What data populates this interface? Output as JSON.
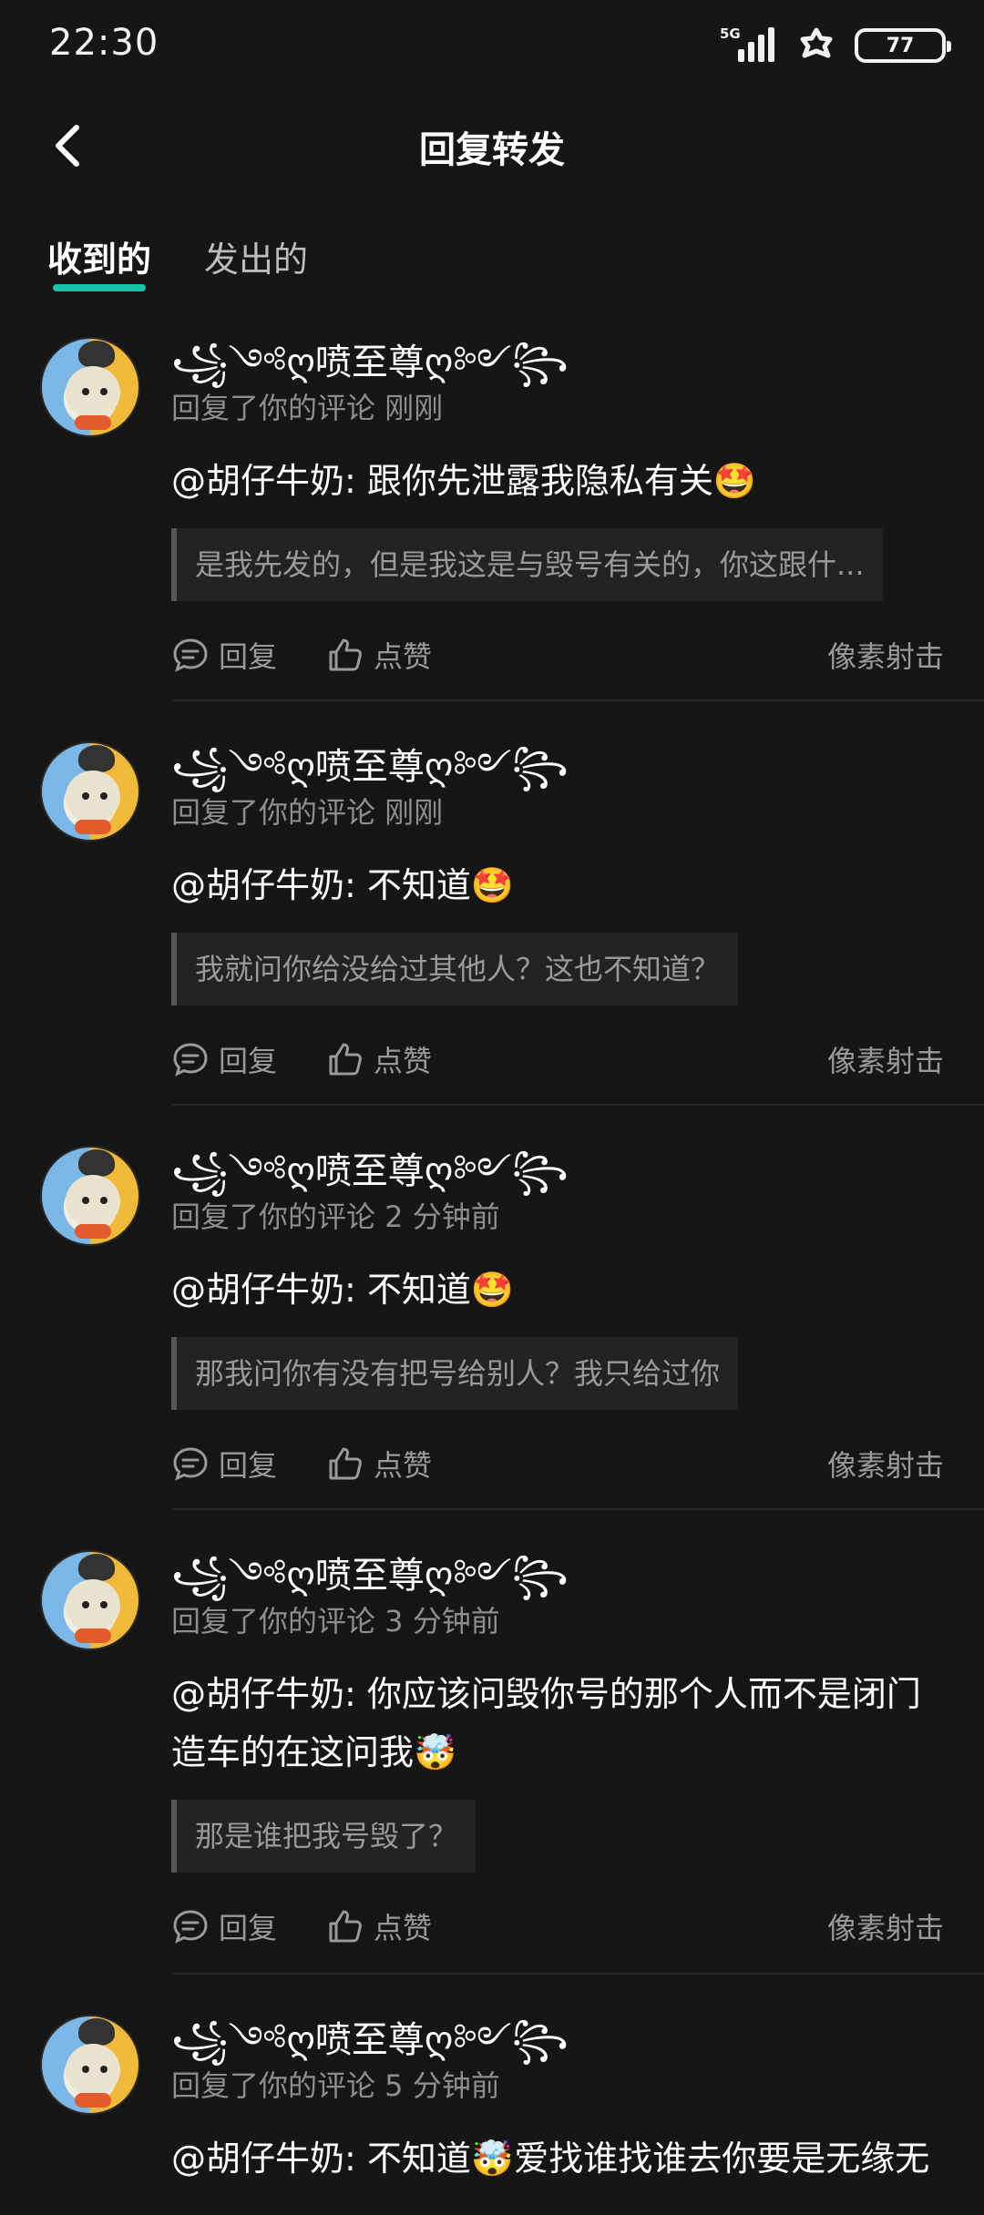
{
  "status_bar": {
    "time": "22:30",
    "network": "5G",
    "battery": "77"
  },
  "header": {
    "title": "回复转发"
  },
  "tabs": [
    {
      "label": "收到的",
      "active": true
    },
    {
      "label": "发出的",
      "active": false
    }
  ],
  "action_labels": {
    "reply": "回复",
    "like": "点赞"
  },
  "items": [
    {
      "username": "꧁༺ღ喷至尊ღ༻꧂",
      "meta": "回复了你的评论 刚刚",
      "text": "@胡仔牛奶: 跟你先泄露我隐私有关🤩",
      "quote": "是我先发的，但是我这是与毁号有关的，你这跟什...",
      "author": "像素射击"
    },
    {
      "username": "꧁༺ღ喷至尊ღ༻꧂",
      "meta": "回复了你的评论 刚刚",
      "text": "@胡仔牛奶: 不知道🤩",
      "quote": "我就问你给没给过其他人？这也不知道？",
      "author": "像素射击"
    },
    {
      "username": "꧁༺ღ喷至尊ღ༻꧂",
      "meta": "回复了你的评论 2 分钟前",
      "text": "@胡仔牛奶: 不知道🤩",
      "quote": "那我问你有没有把号给别人？我只给过你",
      "author": "像素射击"
    },
    {
      "username": "꧁༺ღ喷至尊ღ༻꧂",
      "meta": "回复了你的评论 3 分钟前",
      "text": "@胡仔牛奶: 你应该问毁你号的那个人而不是闭门造车的在这问我🤯",
      "quote": "那是谁把我号毁了？",
      "author": "像素射击"
    },
    {
      "username": "꧁༺ღ喷至尊ღ༻꧂",
      "meta": "回复了你的评论 5 分钟前",
      "text": "@胡仔牛奶: 不知道🤯爱找谁找谁去你要是无缘无",
      "quote": "",
      "author": ""
    }
  ]
}
